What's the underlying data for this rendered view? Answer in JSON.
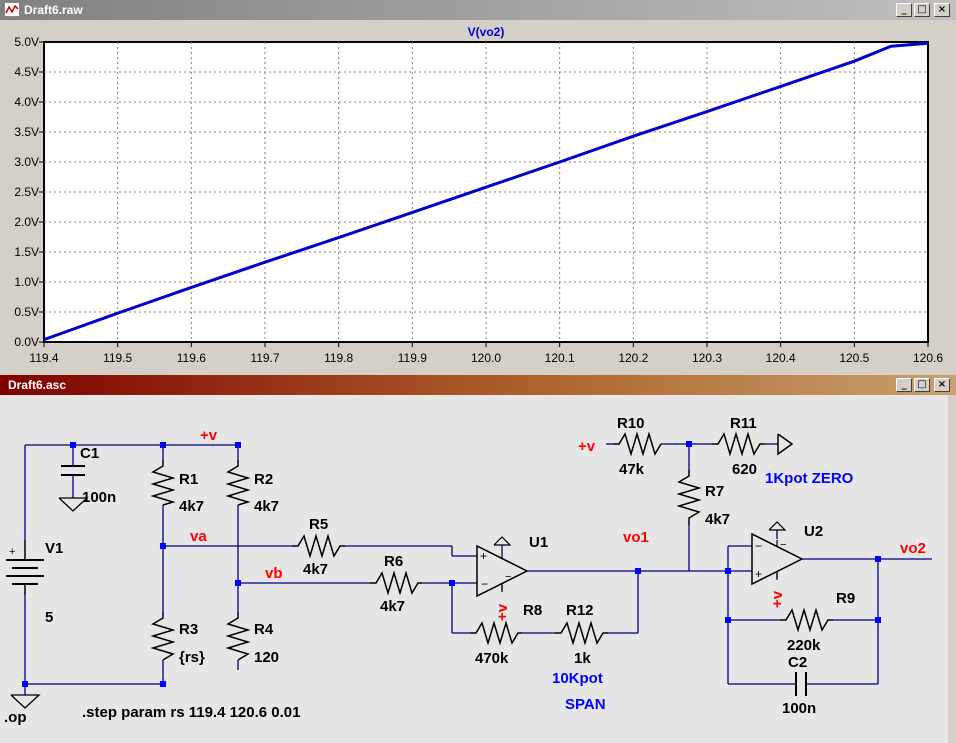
{
  "plot_window": {
    "title": "Draft6.raw",
    "trace_label": "V(vo2)",
    "buttons": {
      "minimize": "_",
      "restore": "□",
      "close": "×"
    }
  },
  "schematic_window": {
    "title": "Draft6.asc",
    "buttons": {
      "minimize": "_",
      "restore": "□",
      "close": "×"
    }
  },
  "chart_data": {
    "type": "line",
    "title": "V(vo2)",
    "xlabel": "",
    "ylabel": "",
    "xlim": [
      119.4,
      120.6
    ],
    "ylim": [
      0.0,
      5.0
    ],
    "x_ticks": [
      "119.4",
      "119.5",
      "119.6",
      "119.7",
      "119.8",
      "119.9",
      "120.0",
      "120.1",
      "120.2",
      "120.3",
      "120.4",
      "120.5",
      "120.6"
    ],
    "y_ticks": [
      "0.0V",
      "0.5V",
      "1.0V",
      "1.5V",
      "2.0V",
      "2.5V",
      "3.0V",
      "3.5V",
      "4.0V",
      "4.5V",
      "5.0V"
    ],
    "grid": true,
    "series": [
      {
        "name": "V(vo2)",
        "color": "#0000cc",
        "x": [
          119.4,
          119.5,
          119.6,
          119.7,
          119.8,
          119.9,
          120.0,
          120.1,
          120.2,
          120.3,
          120.4,
          120.5,
          120.55,
          120.6
        ],
        "y": [
          0.04,
          0.48,
          0.91,
          1.33,
          1.74,
          2.16,
          2.58,
          3.0,
          3.43,
          3.84,
          4.26,
          4.68,
          4.93,
          4.98
        ]
      }
    ]
  },
  "schematic": {
    "net_labels": {
      "plus_v": "+v",
      "plus_v_in": "+v",
      "va": "va",
      "vb": "vb",
      "vo1": "vo1",
      "vo2": "vo2",
      "u1_supply": "+v",
      "u2_supply": "+v"
    },
    "components": {
      "C1": {
        "ref": "C1",
        "value": "100n"
      },
      "V1": {
        "ref": "V1",
        "value": "5"
      },
      "R1": {
        "ref": "R1",
        "value": "4k7"
      },
      "R2": {
        "ref": "R2",
        "value": "4k7"
      },
      "R3": {
        "ref": "R3",
        "value": "{rs}"
      },
      "R4": {
        "ref": "R4",
        "value": "120"
      },
      "R5": {
        "ref": "R5",
        "value": "4k7"
      },
      "R6": {
        "ref": "R6",
        "value": "4k7"
      },
      "R7": {
        "ref": "R7",
        "value": "4k7"
      },
      "R8": {
        "ref": "R8",
        "value": "470k"
      },
      "R9": {
        "ref": "R9",
        "value": "220k"
      },
      "R10": {
        "ref": "R10",
        "value": "47k"
      },
      "R11": {
        "ref": "R11",
        "value": "620"
      },
      "R12": {
        "ref": "R12",
        "value": "1k"
      },
      "C2": {
        "ref": "C2",
        "value": "100n"
      },
      "U1": {
        "ref": "U1"
      },
      "U2": {
        "ref": "U2"
      }
    },
    "comments": {
      "zero": "1Kpot ZERO",
      "span1": "10Kpot",
      "span2": "SPAN"
    },
    "directives": {
      "step": ".step param rs 119.4 120.6 0.01",
      "op": ".op"
    },
    "colors": {
      "wire": "#000080",
      "net_label": "#ff0000",
      "comment": "#0000ff",
      "junction": "#0000ff"
    }
  }
}
